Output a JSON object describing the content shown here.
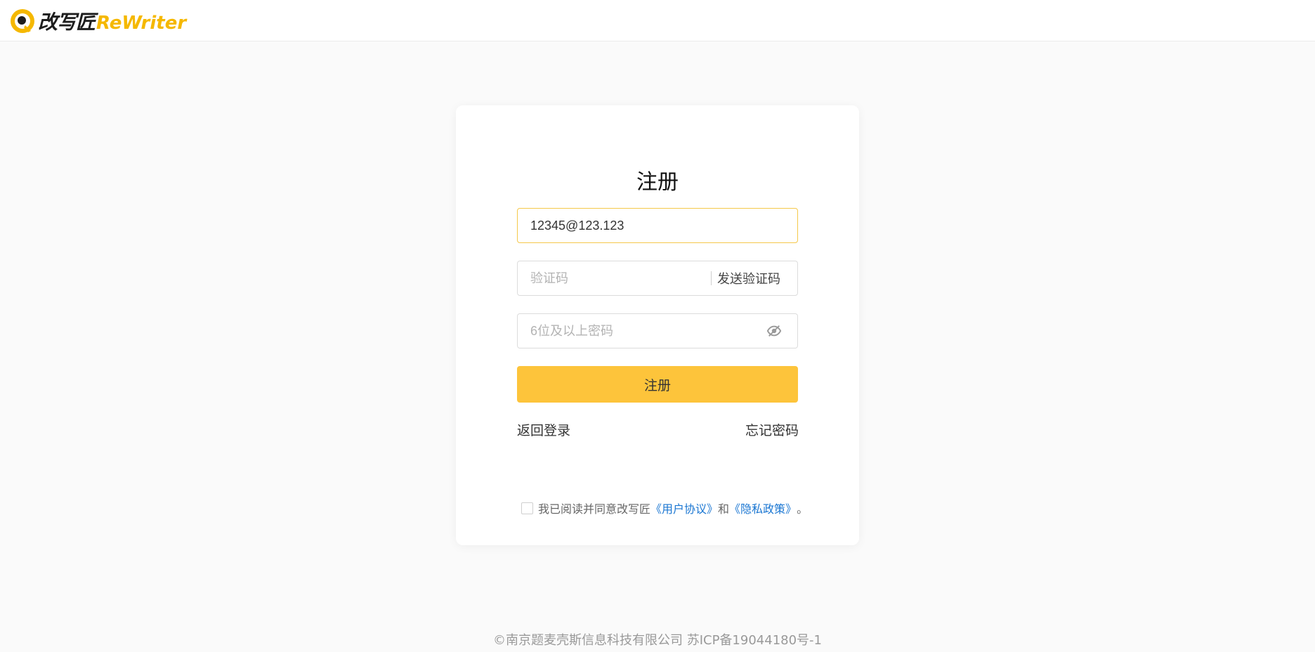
{
  "brand": {
    "name_cn": "改写匠",
    "name_en": "ReWriter",
    "accent_color": "#fdc43b"
  },
  "form": {
    "title": "注册",
    "email": {
      "value": "12345@123.123",
      "placeholder": ""
    },
    "code": {
      "placeholder": "验证码",
      "send_label": "发送验证码"
    },
    "password": {
      "placeholder": "6位及以上密码",
      "toggle_icon": "eye-hidden-icon"
    },
    "submit_label": "注册",
    "back_login_label": "返回登录",
    "forgot_password_label": "忘记密码",
    "agreement": {
      "prefix": "我已阅读并同意改写匠",
      "user_agreement": "《用户协议》",
      "conjunction": "和",
      "privacy_policy": "《隐私政策》",
      "suffix": "。",
      "checked": false
    }
  },
  "footer": {
    "text": "©南京题麦壳斯信息科技有限公司 苏ICP备19044180号-1"
  }
}
